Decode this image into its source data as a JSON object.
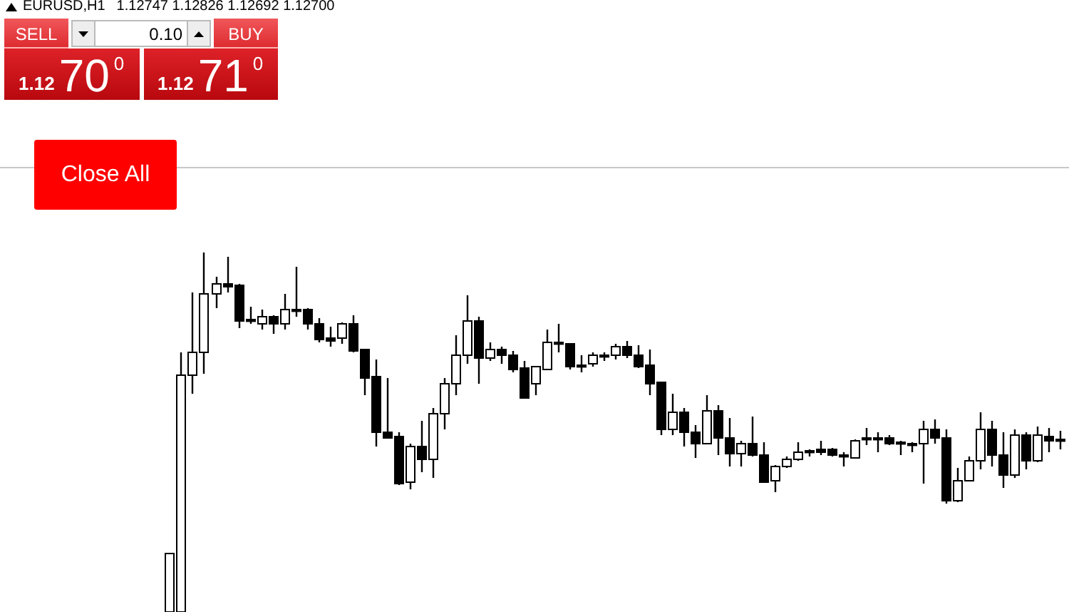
{
  "chart_header": {
    "symbol": "EURUSD,H1",
    "prices": "1.12747 1.12826 1.12692 1.12700"
  },
  "trade_panel": {
    "sell_label": "SELL",
    "buy_label": "BUY",
    "volume": "0.10",
    "sell_price": {
      "prefix": "1.12",
      "pips": "70",
      "fraction": "0"
    },
    "buy_price": {
      "prefix": "1.12",
      "pips": "71",
      "fraction": "0"
    }
  },
  "close_all_button": {
    "label": "Close All"
  }
}
